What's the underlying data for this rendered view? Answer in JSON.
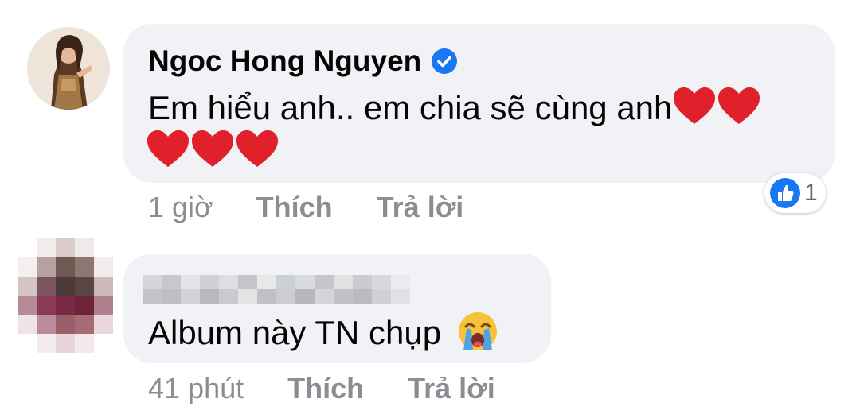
{
  "comments": [
    {
      "author": "Ngoc Hong Nguyen",
      "verified": true,
      "text_line1": "Em hiểu anh.. em chia sẽ cùng anh",
      "hearts_line1": 2,
      "hearts_line2": 3,
      "time": "1 giờ",
      "like_label": "Thích",
      "reply_label": "Trả lời",
      "reaction_icon": "like-icon",
      "reaction_count": "1"
    },
    {
      "author": "",
      "author_blurred": true,
      "text": "Album này TN chụp",
      "emoji_icon": "loudly-crying-face-icon",
      "time": "41 phút",
      "like_label": "Thích",
      "reply_label": "Trả lời"
    }
  ],
  "colors": {
    "bubble_bg": "#f0f2f5",
    "text": "#050505",
    "meta": "#8a8d91",
    "verified_blue": "#1877f2",
    "heart_red": "#e0212b",
    "like_blue": "#1877f2"
  }
}
